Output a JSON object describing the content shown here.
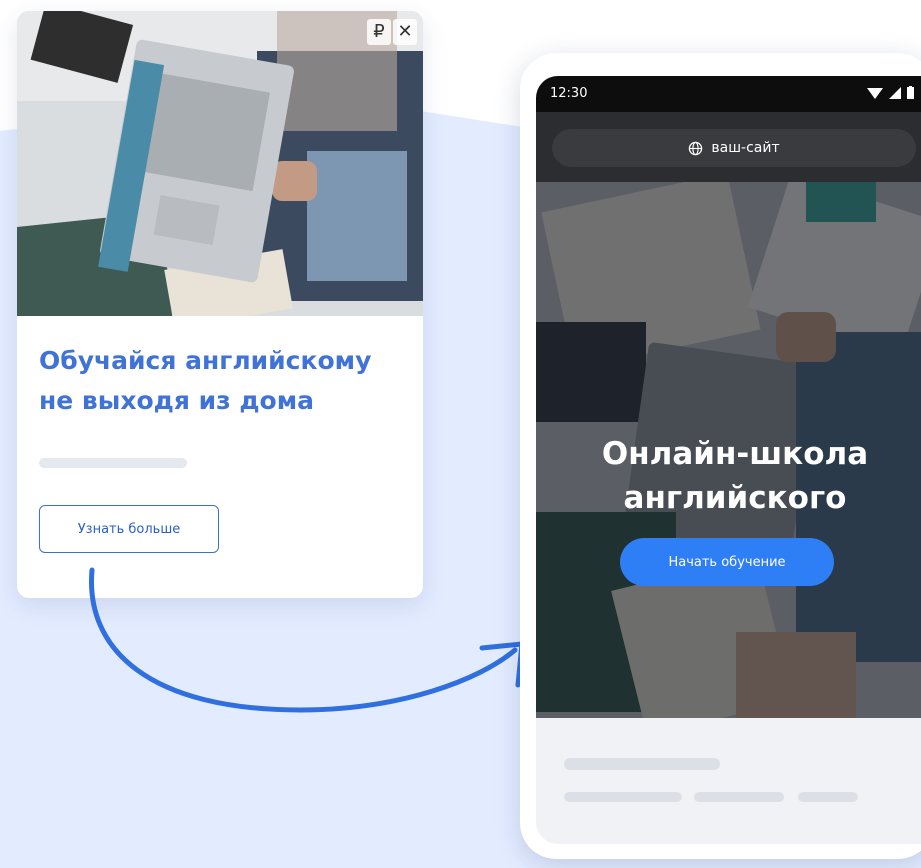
{
  "ad_card": {
    "badge_currency": "₽",
    "badge_close": "✕",
    "title_line1": "Обучайся английскому",
    "title_line2": "не выходя из дома",
    "button_label": "Узнать больше"
  },
  "phone": {
    "status_time": "12:30",
    "url_text": "ваш-сайт",
    "hero_title_line1": "Онлайн-школа",
    "hero_title_line2": "английского",
    "cta_label": "Начать обучение"
  },
  "colors": {
    "accent_blue": "#3f73d8",
    "cta_blue": "#2e7ff5",
    "background_blue": "#e3ecff"
  },
  "icons": [
    "ruble-icon",
    "close-icon",
    "globe-icon",
    "wifi-icon",
    "cellular-icon",
    "battery-icon",
    "curved-arrow-icon"
  ]
}
